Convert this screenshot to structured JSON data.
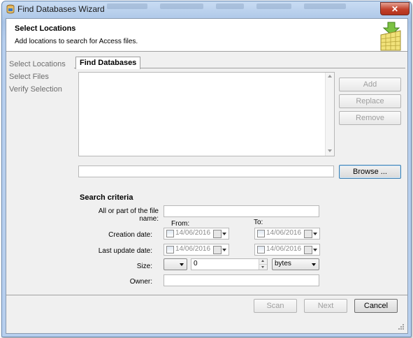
{
  "window": {
    "title": "Find Databases Wizard",
    "close_label": "✕"
  },
  "header": {
    "title": "Select Locations",
    "subtitle": "Add locations to search for Access files."
  },
  "nav": [
    {
      "label": "Select Locations"
    },
    {
      "label": "Select Files"
    },
    {
      "label": "Verify Selection"
    }
  ],
  "tab": {
    "label": "Find Databases"
  },
  "buttons": {
    "add": "Add",
    "replace": "Replace",
    "remove": "Remove",
    "browse": "Browse ...",
    "scan": "Scan",
    "next": "Next",
    "cancel": "Cancel"
  },
  "search": {
    "title": "Search criteria",
    "filename_label": "All or part of the file name:",
    "filename_value": "",
    "from_label": "From:",
    "to_label": "To:",
    "creation_label": "Creation date:",
    "creation_from": "14/06/2016",
    "creation_to": "14/06/2016",
    "update_label": "Last update date:",
    "update_from": "14/06/2016",
    "update_to": "14/06/2016",
    "size_label": "Size:",
    "size_operator": "",
    "size_value": "0",
    "size_unit": "bytes",
    "owner_label": "Owner:",
    "owner_value": ""
  },
  "colors": {
    "accent": "#3c7fb1",
    "close": "#c2412a",
    "disabled_text": "#9e9e9e"
  }
}
